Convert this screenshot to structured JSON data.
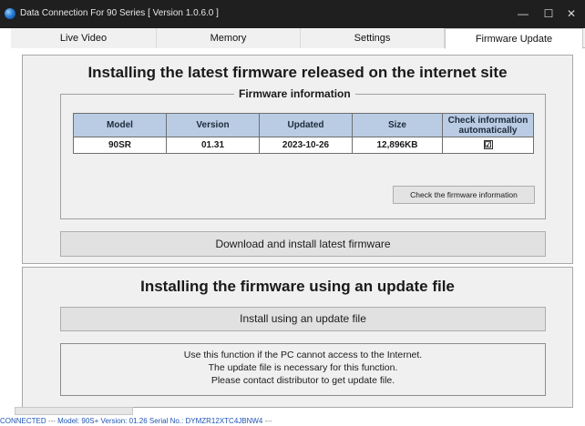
{
  "window": {
    "title": "Data Connection For 90 Series [ Version 1.0.6.0 ]",
    "minimize_glyph": "—",
    "maximize_glyph": "☐",
    "close_glyph": "✕"
  },
  "tabs": [
    {
      "label": "Live Video",
      "active": false
    },
    {
      "label": "Memory",
      "active": false
    },
    {
      "label": "Settings",
      "active": false
    },
    {
      "label": "Firmware Update",
      "active": true
    }
  ],
  "internet_section": {
    "heading": "Installing the latest firmware released on the internet site",
    "group_title": "Firmware information",
    "table": {
      "headers": [
        "Model",
        "Version",
        "Updated",
        "Size",
        "Check information automatically"
      ],
      "rows": [
        {
          "model": "90SR",
          "version": "01.31",
          "updated": "2023-10-26",
          "size": "12,896KB",
          "auto_check": "☑"
        }
      ]
    },
    "check_button": "Check the firmware information",
    "download_button": "Download and install latest firmware"
  },
  "file_section": {
    "heading": "Installing the firmware using an update file",
    "install_button": "Install using an update file",
    "notice": [
      "Use this function if the PC cannot access to the Internet.",
      "The update file is necessary for this function.",
      "Please contact distributor to get update file."
    ]
  },
  "status_bar": {
    "connection": "CONNECTED",
    "separator": "---",
    "model": "Model: 90S+",
    "version": "Version: 01.26",
    "serial": "Serial No.: DYMZR12XTC4JBNW4",
    "trailing_separator": "---"
  },
  "colors": {
    "title_bar": "#1f1f1f",
    "table_header": "#b9cce4",
    "status_text": "#1f55b5",
    "panel_bg": "#f0f0f0"
  }
}
